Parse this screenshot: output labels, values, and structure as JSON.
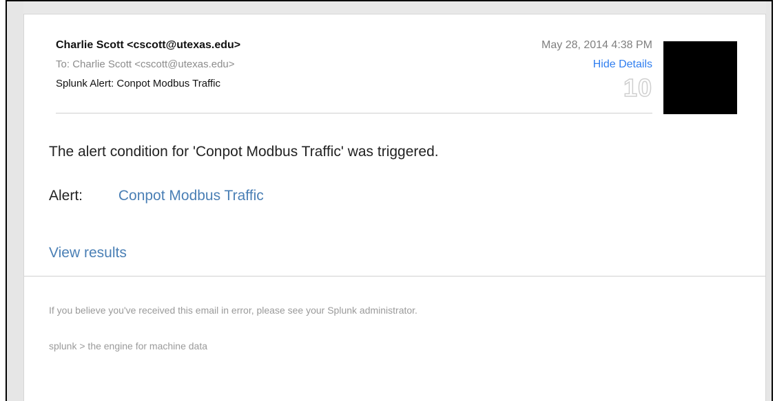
{
  "email": {
    "from": "Charlie Scott <cscott@utexas.edu>",
    "to_label": "To:",
    "to_value": "Charlie Scott <cscott@utexas.edu>",
    "subject": "Splunk Alert: Conpot Modbus Traffic",
    "date": "May 28, 2014  4:38 PM",
    "hide_details": "Hide Details",
    "count": "10"
  },
  "body": {
    "condition_text": "The alert condition for 'Conpot Modbus Traffic' was triggered.",
    "alert_label": "Alert:",
    "alert_link": "Conpot Modbus Traffic",
    "view_results": "View results"
  },
  "footer": {
    "note": "If you believe you've received this email in error, please see your Splunk administrator.",
    "brand": "splunk > the engine for machine data"
  },
  "colors": {
    "link": "#4a7fb5",
    "hide_details": "#2f7ef0",
    "muted": "#9a9a9a"
  }
}
